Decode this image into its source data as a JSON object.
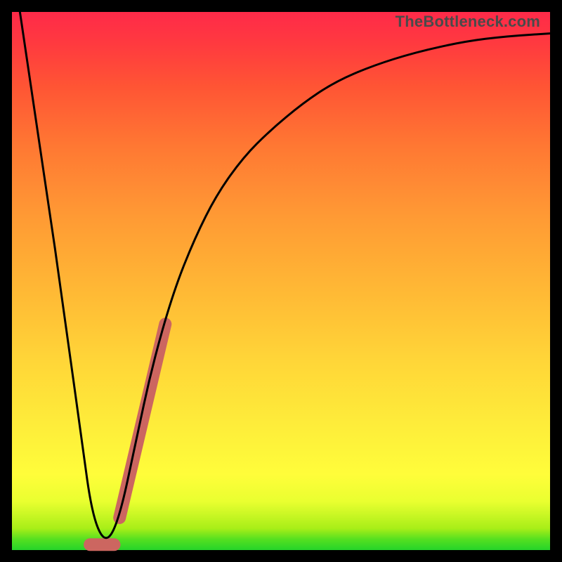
{
  "watermark": "TheBottleneck.com",
  "colors": {
    "frame": "#000000",
    "gradient_top": "#ff2a49",
    "gradient_mid": "#ffd638",
    "gradient_bottom": "#25d42a",
    "curve": "#000000",
    "highlight_segment": "#cc6660"
  },
  "chart_data": {
    "type": "line",
    "title": "",
    "xlabel": "",
    "ylabel": "",
    "xlim": [
      0,
      100
    ],
    "ylim": [
      0,
      100
    ],
    "series": [
      {
        "name": "bottleneck-curve",
        "x": [
          0,
          6,
          10,
          13,
          15,
          17.5,
          20,
          23,
          26,
          30,
          34,
          38,
          43,
          48,
          54,
          60,
          67,
          75,
          84,
          92,
          100
        ],
        "y": [
          110,
          70,
          42,
          20,
          6,
          1,
          6,
          20,
          34,
          48,
          58,
          66,
          73,
          78,
          83,
          87,
          90,
          92.5,
          94.5,
          95.5,
          96
        ]
      }
    ],
    "highlight": {
      "name": "emphasized-range",
      "x": [
        20,
        28.5
      ],
      "y": [
        6,
        42
      ]
    },
    "floor_marker": {
      "x": [
        14.5,
        19
      ],
      "y": [
        1,
        1
      ]
    }
  }
}
